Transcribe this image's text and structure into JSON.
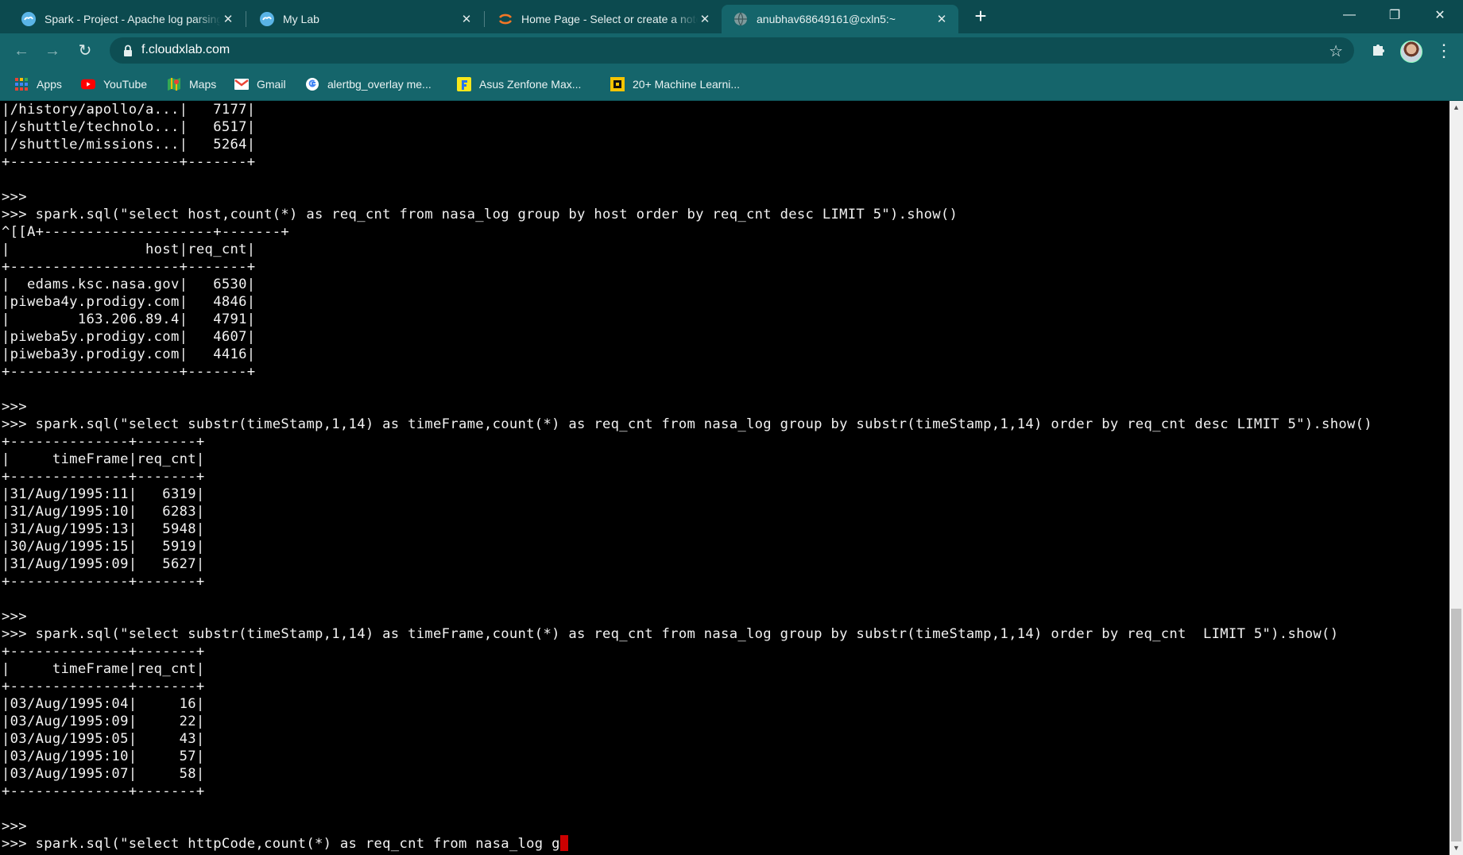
{
  "tabs": [
    {
      "title": "Spark - Project - Apache log parsing",
      "close": "✕",
      "icon": "cloudxlab-icon"
    },
    {
      "title": "My Lab",
      "close": "✕",
      "icon": "cloudxlab-icon"
    },
    {
      "title": "Home Page - Select or create a notebook",
      "close": "✕",
      "icon": "jupyter-icon"
    },
    {
      "title": "anubhav68649161@cxln5:~",
      "close": "✕",
      "icon": "globe-icon"
    }
  ],
  "window_controls": {
    "minimize": "—",
    "maximize": "❐",
    "close": "✕"
  },
  "new_tab": "+",
  "toolbar": {
    "back": "←",
    "forward": "→",
    "reload": "↻",
    "url": "f.cloudxlab.com",
    "star": "☆",
    "menu": "⋮"
  },
  "bookmarks": [
    {
      "label": "Apps",
      "icon": "apps-grid-icon"
    },
    {
      "label": "YouTube",
      "icon": "youtube-icon"
    },
    {
      "label": "Maps",
      "icon": "maps-icon"
    },
    {
      "label": "Gmail",
      "icon": "gmail-icon"
    },
    {
      "label": "alertbg_overlay me...",
      "icon": "google-icon"
    },
    {
      "label": "Asus Zenfone Max...",
      "icon": "flipkart-icon"
    },
    {
      "label": "20+ Machine Learni...",
      "icon": "bookmark-square-icon"
    }
  ],
  "terminal": {
    "lines": [
      "|/history/apollo/a...|   7177|",
      "|/shuttle/technolo...|   6517|",
      "|/shuttle/missions...|   5264|",
      "+--------------------+-------+",
      "",
      ">>>",
      ">>> spark.sql(\"select host,count(*) as req_cnt from nasa_log group by host order by req_cnt desc LIMIT 5\").show()",
      "^[[A+--------------------+-------+",
      "|                host|req_cnt|",
      "+--------------------+-------+",
      "|  edams.ksc.nasa.gov|   6530|",
      "|piweba4y.prodigy.com|   4846|",
      "|        163.206.89.4|   4791|",
      "|piweba5y.prodigy.com|   4607|",
      "|piweba3y.prodigy.com|   4416|",
      "+--------------------+-------+",
      "",
      ">>>",
      ">>> spark.sql(\"select substr(timeStamp,1,14) as timeFrame,count(*) as req_cnt from nasa_log group by substr(timeStamp,1,14) order by req_cnt desc LIMIT 5\").show()",
      "+--------------+-------+",
      "|     timeFrame|req_cnt|",
      "+--------------+-------+",
      "|31/Aug/1995:11|   6319|",
      "|31/Aug/1995:10|   6283|",
      "|31/Aug/1995:13|   5948|",
      "|30/Aug/1995:15|   5919|",
      "|31/Aug/1995:09|   5627|",
      "+--------------+-------+",
      "",
      ">>>",
      ">>> spark.sql(\"select substr(timeStamp,1,14) as timeFrame,count(*) as req_cnt from nasa_log group by substr(timeStamp,1,14) order by req_cnt  LIMIT 5\").show()",
      "+--------------+-------+",
      "|     timeFrame|req_cnt|",
      "+--------------+-------+",
      "|03/Aug/1995:04|     16|",
      "|03/Aug/1995:09|     22|",
      "|03/Aug/1995:05|     43|",
      "|03/Aug/1995:10|     57|",
      "|03/Aug/1995:07|     58|",
      "+--------------+-------+",
      "",
      ">>>"
    ],
    "input_line": ">>> spark.sql(\"select httpCode,count(*) as req_cnt from nasa_log g"
  },
  "scrollbar": {
    "up": "▲",
    "down": "▼",
    "thumb_position": 0.68,
    "thumb_size": 0.32
  },
  "colors": {
    "tabstrip": "#0c4a4f",
    "toolbar": "#15656b",
    "terminal_bg": "#000000",
    "terminal_fg": "#f2f2f2",
    "cursor": "#cc0000"
  }
}
